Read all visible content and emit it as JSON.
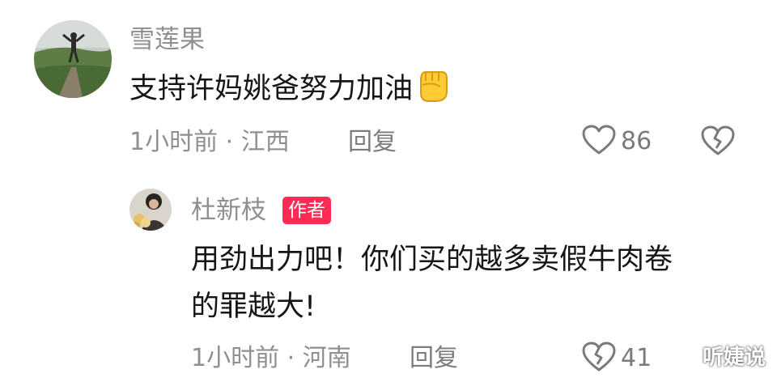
{
  "comments": [
    {
      "username": "雪莲果",
      "content": "支持许妈姚爸努力加油",
      "emoji": "raised-fist-emoji",
      "meta": "1小时前 · 江西",
      "reply_label": "回复",
      "like_count": "86"
    }
  ],
  "reply": {
    "username": "杜新枝",
    "badge": "作者",
    "content_line1": "用劲出力吧！你们买的越多卖假牛肉卷",
    "content_line2": "的罪越大!",
    "meta": "1小时前 · 河南",
    "reply_label": "回复",
    "like_count": "41"
  },
  "watermark": "听婕说",
  "colors": {
    "badge_bg": "#fe2c55",
    "meta": "#8e8e93",
    "text": "#161616"
  }
}
